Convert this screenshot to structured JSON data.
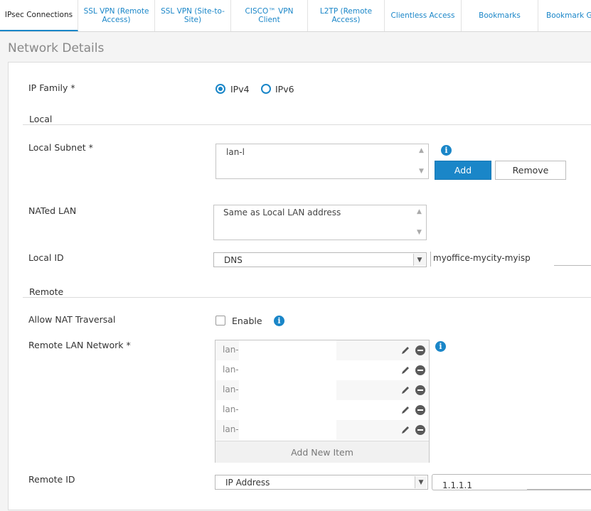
{
  "tabs": [
    {
      "label": "IPsec Connections",
      "active": true
    },
    {
      "label": "SSL VPN (Remote Access)",
      "active": false
    },
    {
      "label": "SSL VPN (Site-to-Site)",
      "active": false
    },
    {
      "label": "CISCO™ VPN Client",
      "active": false
    },
    {
      "label": "L2TP (Remote Access)",
      "active": false
    },
    {
      "label": "Clientless Access",
      "active": false
    },
    {
      "label": "Bookmarks",
      "active": false
    },
    {
      "label": "Bookmark Gr",
      "active": false
    }
  ],
  "section_title": "Network Details",
  "ip_family": {
    "label": "IP Family *",
    "options": [
      {
        "label": "IPv4",
        "selected": true
      },
      {
        "label": "IPv6",
        "selected": false
      }
    ]
  },
  "local": {
    "heading": "Local",
    "subnet": {
      "label": "Local Subnet *",
      "value": "lan-l",
      "add_label": "Add",
      "remove_label": "Remove"
    },
    "nated_lan": {
      "label": "NATed LAN",
      "value": "Same as Local LAN address"
    },
    "local_id": {
      "label": "Local ID",
      "type_value": "DNS",
      "value": "myoffice-mycity-myisp"
    }
  },
  "remote": {
    "heading": "Remote",
    "nat_traversal": {
      "label": "Allow NAT Traversal",
      "checkbox_label": "Enable",
      "checked": false
    },
    "lan_network": {
      "label": "Remote LAN Network *",
      "items": [
        "lan-",
        "lan-",
        "lan-",
        "lan-",
        "lan-"
      ],
      "add_new_label": "Add New Item"
    },
    "remote_id": {
      "label": "Remote ID",
      "type_value": "IP Address",
      "value": "1.1.1.1"
    }
  },
  "colors": {
    "accent": "#1a86c8"
  },
  "icons": {
    "info": "info-icon",
    "edit": "pencil-icon",
    "remove": "minus-circle-icon",
    "dropdown": "chevron-down-icon"
  }
}
